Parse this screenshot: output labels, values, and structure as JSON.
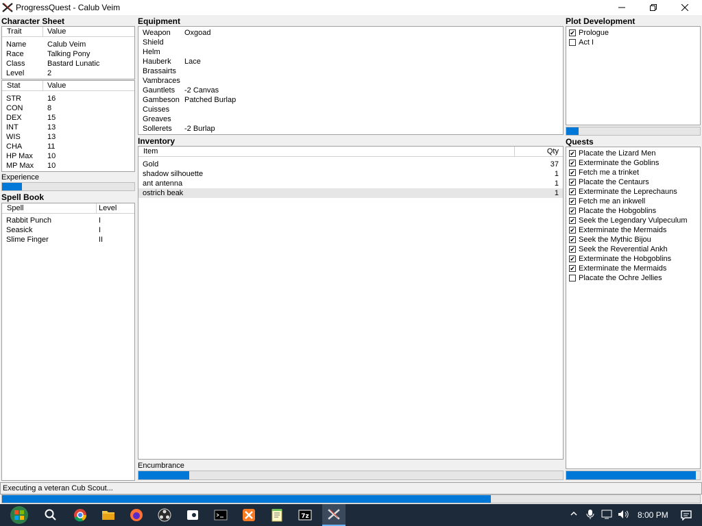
{
  "window": {
    "title": "ProgressQuest - Calub Veim"
  },
  "character_sheet": {
    "label": "Character Sheet",
    "headers": [
      "Trait",
      "Value"
    ],
    "traits": [
      {
        "k": "Name",
        "v": "Calub Veim"
      },
      {
        "k": "Race",
        "v": "Talking Pony"
      },
      {
        "k": "Class",
        "v": "Bastard Lunatic"
      },
      {
        "k": "Level",
        "v": "2"
      }
    ],
    "stat_headers": [
      "Stat",
      "Value"
    ],
    "stats": [
      {
        "k": "STR",
        "v": "16"
      },
      {
        "k": "CON",
        "v": "8"
      },
      {
        "k": "DEX",
        "v": "15"
      },
      {
        "k": "INT",
        "v": "13"
      },
      {
        "k": "WIS",
        "v": "13"
      },
      {
        "k": "CHA",
        "v": "11"
      },
      {
        "k": "HP Max",
        "v": "10"
      },
      {
        "k": "MP Max",
        "v": "10"
      }
    ]
  },
  "experience": {
    "label": "Experience",
    "progress": 0.15
  },
  "spell_book": {
    "label": "Spell Book",
    "headers": [
      "Spell",
      "Level"
    ],
    "spells": [
      {
        "k": "Rabbit Punch",
        "v": "I"
      },
      {
        "k": "Seasick",
        "v": "I"
      },
      {
        "k": "Slime Finger",
        "v": "II"
      }
    ]
  },
  "equipment": {
    "label": "Equipment",
    "items": [
      {
        "k": "Weapon",
        "v": "Oxgoad"
      },
      {
        "k": "Shield",
        "v": ""
      },
      {
        "k": "Helm",
        "v": ""
      },
      {
        "k": "Hauberk",
        "v": "Lace"
      },
      {
        "k": "Brassairts",
        "v": ""
      },
      {
        "k": "Vambraces",
        "v": ""
      },
      {
        "k": "Gauntlets",
        "v": "-2 Canvas"
      },
      {
        "k": "Gambeson",
        "v": "Patched Burlap"
      },
      {
        "k": "Cuisses",
        "v": ""
      },
      {
        "k": "Greaves",
        "v": ""
      },
      {
        "k": "Sollerets",
        "v": "-2 Burlap"
      }
    ]
  },
  "inventory": {
    "label": "Inventory",
    "headers": [
      "Item",
      "Qty"
    ],
    "items": [
      {
        "k": "Gold",
        "v": "37"
      },
      {
        "k": "shadow silhouette",
        "v": "1"
      },
      {
        "k": "ant antenna",
        "v": "1"
      },
      {
        "k": "ostrich beak",
        "v": "1"
      }
    ]
  },
  "encumbrance": {
    "label": "Encumbrance",
    "progress": 0.12
  },
  "plot": {
    "label": "Plot Development",
    "acts": [
      {
        "label": "Prologue",
        "done": true
      },
      {
        "label": "Act I",
        "done": false
      }
    ],
    "progress": 0.09
  },
  "quests": {
    "label": "Quests",
    "items": [
      {
        "label": "Placate the Lizard Men",
        "done": true
      },
      {
        "label": "Exterminate the Goblins",
        "done": true
      },
      {
        "label": "Fetch me a trinket",
        "done": true
      },
      {
        "label": "Placate the Centaurs",
        "done": true
      },
      {
        "label": "Exterminate the Leprechauns",
        "done": true
      },
      {
        "label": "Fetch me an inkwell",
        "done": true
      },
      {
        "label": "Placate the Hobgoblins",
        "done": true
      },
      {
        "label": "Seek the Legendary Vulpeculum",
        "done": true
      },
      {
        "label": "Exterminate the Mermaids",
        "done": true
      },
      {
        "label": "Seek the Mythic Bijou",
        "done": true
      },
      {
        "label": "Seek the Reverential Ankh",
        "done": true
      },
      {
        "label": "Exterminate the Hobgoblins",
        "done": true
      },
      {
        "label": "Exterminate the Mermaids",
        "done": true
      },
      {
        "label": "Placate the Ochre Jellies",
        "done": false
      }
    ],
    "progress": 0.97
  },
  "status": {
    "text": "Executing a veteran Cub Scout...",
    "progress": 0.7
  },
  "taskbar": {
    "time": "8:00 PM"
  },
  "colors": {
    "accent": "#0078d7",
    "taskbar": "#1c2a3a"
  }
}
